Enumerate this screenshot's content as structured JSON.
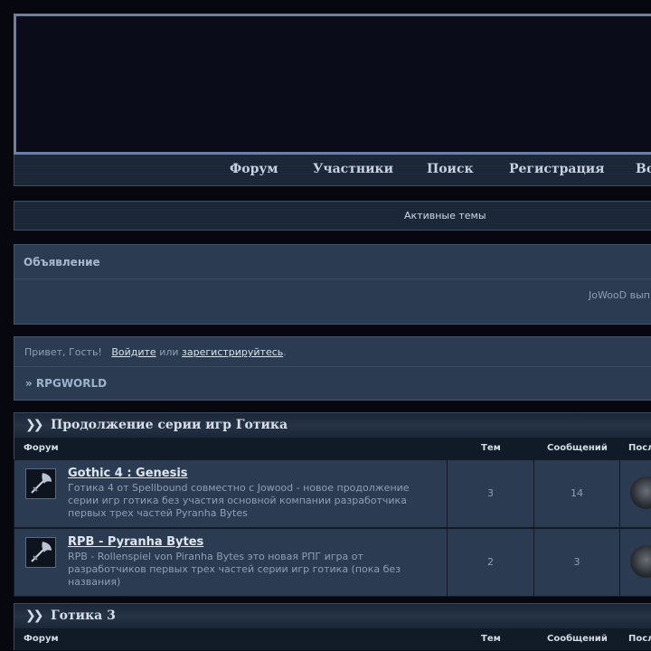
{
  "nav": {
    "items": [
      {
        "label": "Форум"
      },
      {
        "label": "Участники"
      },
      {
        "label": "Поиск"
      },
      {
        "label": "Регистрация"
      },
      {
        "label": "Во"
      }
    ]
  },
  "active_topics": "Активные темы",
  "announcement": {
    "title": "Объявление",
    "text": "JoWooD вып"
  },
  "guest": {
    "greeting": "Привет, Гость!",
    "login": "Войдите",
    "or": "или",
    "register": "зарегистрируйтесь",
    "period": ".",
    "breadcrumb": "» RPGWORLD"
  },
  "columns": {
    "forum": "Форум",
    "topics": "Тем",
    "posts": "Сообщений",
    "last": "Посл"
  },
  "categories": [
    {
      "title": "Продолжение серии игр Готика",
      "forums": [
        {
          "title": "Gothic 4 : Genesis",
          "description": "Готика 4 от Spellbound совместно с Jowood - новое продолжение серии игр готика без участия основной компании разработчика первых трех частей Pyranha Bytes",
          "topics": "3",
          "posts": "14"
        },
        {
          "title": "RPB - Pyranha Bytes",
          "description": "RPB - Rollenspiel von Piranha Bytes это новая РПГ игра от разработчиков первых трех частей серии игр готика (пока без названия)",
          "topics": "2",
          "posts": "3"
        }
      ]
    },
    {
      "title": "Готика 3",
      "forums": []
    }
  ],
  "icons": {
    "category_arrows": "double-chevron-right-icon",
    "forum_icon": "axe-icon",
    "last_post_avatar": "avatar-icon"
  }
}
